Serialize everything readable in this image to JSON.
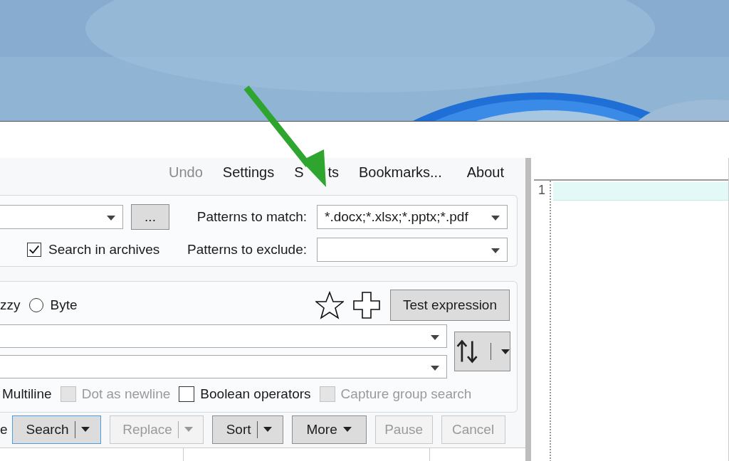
{
  "menu": [
    {
      "label": "Undo",
      "disabled": true
    },
    {
      "label": "Settings",
      "disabled": false
    },
    {
      "parts": [
        "S",
        "ts"
      ],
      "disabled": false
    },
    {
      "label": "Bookmarks...",
      "disabled": false
    },
    {
      "label": "About",
      "disabled": false
    }
  ],
  "location": {
    "browse_button": "...",
    "archives": {
      "label": "Search in archives",
      "checked": true
    }
  },
  "patterns": {
    "match_label": "Patterns to match:",
    "match_value": "*.docx;*.xlsx;*.pptx;*.pdf",
    "exclude_label": "Patterns to exclude:"
  },
  "search_for": {
    "fuzzy_fragment": "zzy",
    "byte": {
      "label": "Byte",
      "selected": false
    },
    "test_button": "Test expression"
  },
  "options": [
    {
      "label": "Multiline",
      "kind": "cut"
    },
    {
      "label": "Dot as newline",
      "kind": "checkbox",
      "checked": false,
      "disabled": true
    },
    {
      "label": "Boolean operators",
      "kind": "checkbox",
      "checked": false,
      "disabled": false
    },
    {
      "label": "Capture group search",
      "kind": "checkbox",
      "checked": false,
      "disabled": true
    }
  ],
  "actions_fragment": "e",
  "actions": [
    {
      "label": "Search",
      "kind": "split",
      "disabled": false,
      "focused": true
    },
    {
      "label": "Replace",
      "kind": "split",
      "disabled": true,
      "focused": false
    },
    {
      "label": "Sort",
      "kind": "split",
      "disabled": false,
      "focused": false
    },
    {
      "label": "More",
      "kind": "menu",
      "disabled": false,
      "focused": false
    },
    {
      "label": "Pause",
      "kind": "plain",
      "disabled": true,
      "focused": false
    },
    {
      "label": "Cancel",
      "kind": "plain",
      "disabled": true,
      "focused": false
    }
  ],
  "editor": {
    "line_numbers": [
      "1"
    ]
  }
}
